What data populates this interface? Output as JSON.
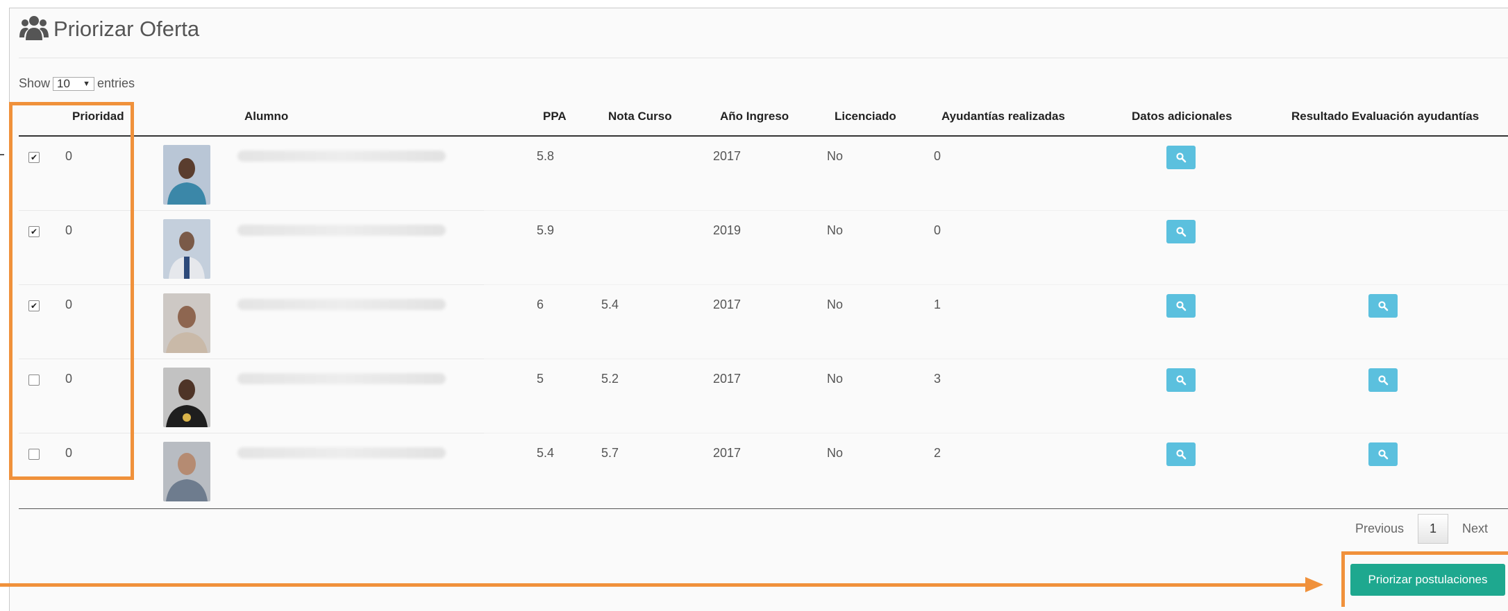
{
  "header": {
    "title": "Priorizar Oferta",
    "icon": "users-icon"
  },
  "length": {
    "show_label": "Show",
    "value": "10",
    "entries_label": "entries"
  },
  "table": {
    "columns": [
      "Prioridad",
      "Alumno",
      "PPA",
      "Nota Curso",
      "Año Ingreso",
      "Licenciado",
      "Ayudantías realizadas",
      "Datos adicionales",
      "Resultado Evaluación ayudantías"
    ],
    "rows": [
      {
        "checked": true,
        "prioridad": "0",
        "ppa": "5.8",
        "nota": "",
        "ingreso": "2017",
        "licenciado": "No",
        "ayudantias": "0",
        "has_resultado": false
      },
      {
        "checked": true,
        "prioridad": "0",
        "ppa": "5.9",
        "nota": "",
        "ingreso": "2019",
        "licenciado": "No",
        "ayudantias": "0",
        "has_resultado": false
      },
      {
        "checked": true,
        "prioridad": "0",
        "ppa": "6",
        "nota": "5.4",
        "ingreso": "2017",
        "licenciado": "No",
        "ayudantias": "1",
        "has_resultado": true
      },
      {
        "checked": false,
        "prioridad": "0",
        "ppa": "5",
        "nota": "5.2",
        "ingreso": "2017",
        "licenciado": "No",
        "ayudantias": "3",
        "has_resultado": true
      },
      {
        "checked": false,
        "prioridad": "0",
        "ppa": "5.4",
        "nota": "5.7",
        "ingreso": "2017",
        "licenciado": "No",
        "ayudantias": "2",
        "has_resultado": true
      }
    ]
  },
  "pagination": {
    "previous": "Previous",
    "page": "1",
    "next": "Next"
  },
  "actions": {
    "priorizar_label": "Priorizar postulaciones"
  },
  "colors": {
    "accent_orange": "#f0913b",
    "info_button": "#5bc0de",
    "primary_button": "#1ea88f"
  }
}
